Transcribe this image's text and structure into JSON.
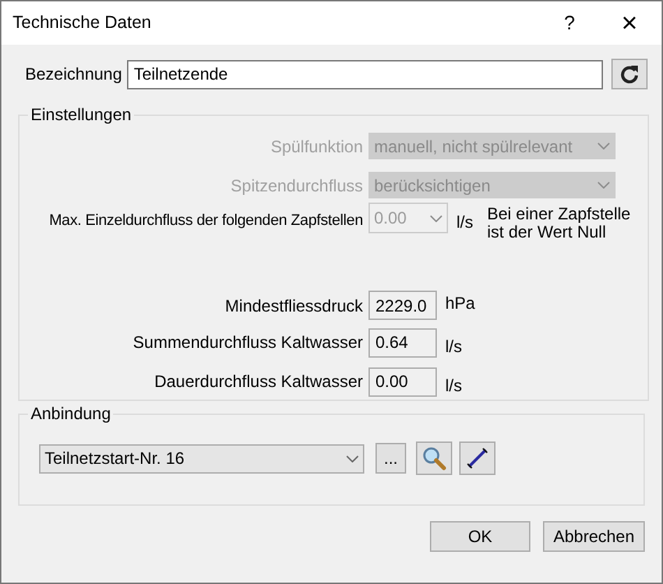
{
  "window": {
    "title": "Technische Daten",
    "help": "?",
    "close": "×"
  },
  "bezeichnung": {
    "label": "Bezeichnung",
    "value": "Teilnetzende"
  },
  "einstellungen": {
    "legend": "Einstellungen",
    "selects": [
      {
        "label": "Spülfunktion",
        "value": "manuell, nicht spülrelevant",
        "disabled": true
      },
      {
        "label": "Spitzendurchfluss",
        "value": "berücksichtigen",
        "disabled": true
      }
    ],
    "max": {
      "label": "Max. Einzeldurchfluss der folgenden Zapfstellen",
      "value": "0.00",
      "unit": "l/s",
      "note": "Bei einer Zapfstelle ist der Wert Null",
      "disabled": true
    },
    "fields": [
      {
        "label": "Mindestfliessdruck",
        "value": "2229.0",
        "unit": "hPa"
      },
      {
        "label": "Summendurchfluss Kaltwasser",
        "value": "0.64",
        "unit": "l/s"
      },
      {
        "label": "Dauerdurchfluss Kaltwasser",
        "value": "0.00",
        "unit": "l/s"
      }
    ]
  },
  "anbindung": {
    "legend": "Anbindung",
    "value": "Teilnetzstart-Nr. 16",
    "more": "..."
  },
  "buttons": [
    "OK",
    "Abbrechen"
  ]
}
